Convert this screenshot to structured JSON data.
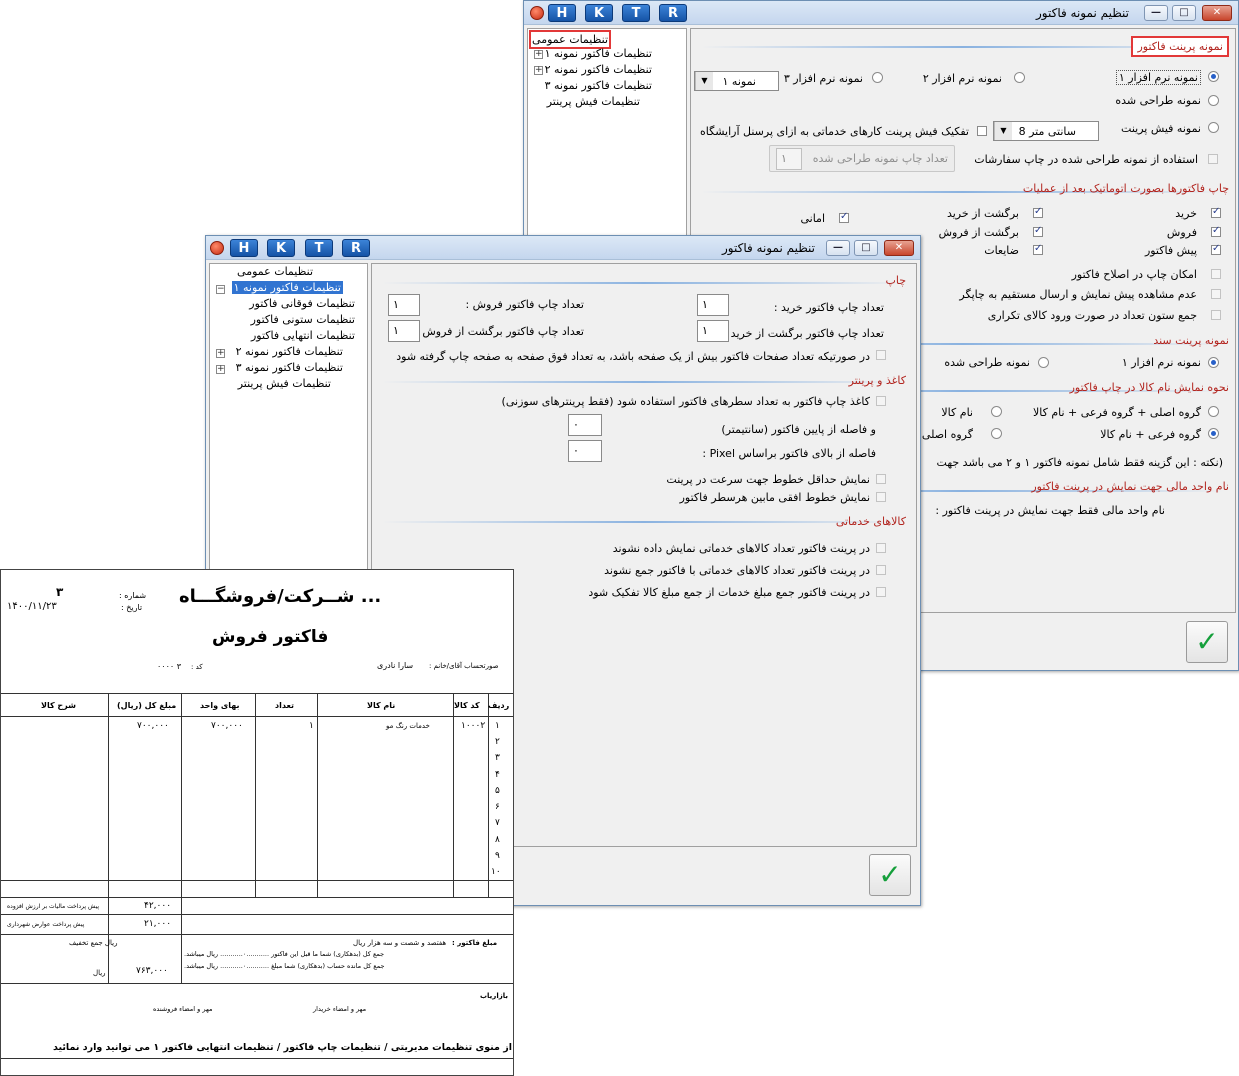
{
  "back_window": {
    "title": "تنظیم نمونه فاکتور",
    "hk_buttons": [
      "H",
      "K",
      "T",
      "R"
    ],
    "tree": [
      {
        "label": "تنظیمات عمومی"
      },
      {
        "label": "تنظیمات فاکتور نمونه ۱"
      },
      {
        "label": "تنظیمات فاکتور نمونه ۲"
      },
      {
        "label": "تنظیمات فاکتور نمونه ۳"
      },
      {
        "label": "تنظیمات فیش پرینتر"
      }
    ],
    "sec_print_sample": "نمونه پرینت فاکتور",
    "radio_soft1": "نمونه نرم افزار ۱",
    "radio_soft2": "نمونه نرم افزار ۲",
    "radio_soft3": "نمونه نرم افزار ۳",
    "combo_sample": "نمونه ۱",
    "radio_designed": "نمونه طراحی شده",
    "radio_receipt": "نمونه فیش پرینت",
    "combo_paper": "سانتی متر 8",
    "cb_separate": "تفکیک فیش پرینت کارهای خدماتی به ازای پرسنل آرایشگاه",
    "cb_use_designed": "استفاده از نمونه طراحی شده در چاپ سفارشات",
    "designed_count_label": "تعداد چاپ نمونه طراحی شده",
    "designed_count_value": "۱",
    "sec_auto_print": "چاپ فاکتورها بصورت اتوماتیک بعد از عملیات",
    "cb_buy": "خرید",
    "cb_return_buy": "برگشت از خرید",
    "cb_trust": "امانی",
    "cb_sell": "فروش",
    "cb_return_sell": "برگشت از فروش",
    "cb_pre": "پیش فاکتور",
    "cb_waste": "ضایعات",
    "cb_edit_print": "امکان چاپ در اصلاح فاکتور",
    "cb_no_preview": "عدم مشاهده پیش نمایش و ارسال مستقیم به چاپگر",
    "cb_sum_column": "جمع ستون تعداد در صورت ورود کالای تکراری",
    "sec_doc_sample": "نمونه پرینت سند",
    "radio_doc_soft1": "نمونه نرم افزار ۱",
    "radio_doc_designed": "نمونه طراحی شده",
    "sec_name_display": "نحوه نمایش نام کالا در چاپ فاکتور",
    "radio_main_sub_name": "گروه اصلی + گروه فرعی + نام کالا",
    "radio_name_only": "نام کالا",
    "radio_sub_name": "گروه فرعی + نام کالا",
    "radio_main_name": "گروه اصلی",
    "note": "(نکته : این گزینه فقط شامل نمونه فاکتور ۱ و ۲ می باشد جهت",
    "sec_currency": "نام واحد مالی جهت نمایش در پرینت فاکتور",
    "currency_label": "نام واحد مالی فقط جهت نمایش در پرینت فاکتور :"
  },
  "front_window": {
    "title": "تنظیم نمونه فاکتور",
    "hk_buttons": [
      "H",
      "K",
      "T",
      "R"
    ],
    "tree": [
      {
        "label": "تنظیمات عمومی"
      },
      {
        "label": "تنظیمات فاکتور نمونه ۱"
      },
      {
        "label": "تنظیمات فوقانی فاکتور"
      },
      {
        "label": "تنظیمات ستونی فاکتور"
      },
      {
        "label": "تنظیمات انتهایی فاکتور"
      },
      {
        "label": "تنظیمات فاکتور نمونه ۲"
      },
      {
        "label": "تنظیمات فاکتور نمونه ۳"
      },
      {
        "label": "تنظیمات فیش پرینتر"
      }
    ],
    "sec_print": "چاپ",
    "buy_count_label": "تعداد چاپ فاکتور خرید :",
    "buy_count_value": "۱",
    "sell_count_label": "تعداد چاپ فاکتور فروش :",
    "sell_count_value": "۱",
    "ret_buy_label": "تعداد چاپ فاکتور برگشت از خرید :",
    "ret_buy_value": "۱",
    "ret_sell_label": "تعداد چاپ فاکتور برگشت از فروش :",
    "ret_sell_value": "۱",
    "cb_multi_page": "در صورتیکه تعداد صفحات فاکتور بیش از یک صفحه باشد، به تعداد فوق صفحه به صفحه چاپ گرفته شود",
    "sec_paper": "کاغذ و پرینتر",
    "cb_paper_rows": "کاغذ چاپ فاکتور به تعداد سطرهای فاکتور استفاده شود (فقط پرینترهای سوزنی)",
    "bottom_margin_label": "و فاصله از پایین فاکتور (سانتیمتر)",
    "bottom_margin_value": "۰",
    "top_margin_label": "فاصله از بالای فاکتور براساس Pixel :",
    "top_margin_value": "۰",
    "cb_min_lines": "نمایش حداقل خطوط جهت سرعت در پرینت",
    "cb_hlines": "نمایش خطوط افقی مابین هرسطر فاکتور",
    "sec_service": "کالاهای خدماتی",
    "cb_svc_count": "در پرینت فاکتور تعداد کالاهای خدماتی نمایش داده نشوند",
    "cb_svc_sum": "در پرینت فاکتور تعداد کالاهای خدماتی با فاکتور جمع نشوند",
    "cb_svc_separate": "در پرینت فاکتور جمع مبلغ خدمات از جمع مبلغ کالا تفکیک شود"
  },
  "invoice": {
    "company": "... شــرکت/فروشگـــاه",
    "title": "فاکتور فروش",
    "number_label": "شماره :",
    "number_value": "۳",
    "date_label": "تاریخ :",
    "date_value": "۱۴۰۰/۱۱/۲۳",
    "customer_label": "صورتحساب  آقای/خانم :",
    "customer_name": "سارا نادری",
    "code_label": "کد :",
    "code_value": "۳ ۰۰۰۰",
    "columns": [
      "ردیف",
      "کد کالا",
      "نام کالا",
      "تعداد",
      "بهای واحد",
      "مبلغ کل (ریال)",
      "شرح کالا"
    ],
    "rows": [
      {
        "n": "۱",
        "code": "۱۰۰۰۲",
        "name": "خدمات رنگ مو",
        "qty": "۱",
        "price": "۷۰۰,۰۰۰",
        "total": "۷۰۰,۰۰۰",
        "desc": ""
      },
      {
        "n": "۲"
      },
      {
        "n": "۳"
      },
      {
        "n": "۴"
      },
      {
        "n": "۵"
      },
      {
        "n": "۶"
      },
      {
        "n": "۷"
      },
      {
        "n": "۸"
      },
      {
        "n": "۹"
      },
      {
        "n": "۱۰"
      }
    ],
    "vat_label": "پیش پرداخت مالیات بر ارزش افزوده",
    "vat_value": "۴۲,۰۰۰",
    "municipal_label": "پیش پرداخت عوارض شهرداری",
    "municipal_value": "۲۱,۰۰۰",
    "discount_label": "ریال جمع تخفیف",
    "rial_label": "ریال",
    "grand_total": "۷۶۳,۰۰۰",
    "amount_words_label": "مبلغ فاکتور :",
    "amount_words": "هفتصد و شصت و سه هزار  ریال",
    "prev_balance": "جمع کل  (بدهکاری) شما ما قبل این فاکتور ...........۰........... ریال میباشد.",
    "remaining_balance": "جمع کل مانده حساب  (بدهکاری)  شما مبلغ  ...........۰........... ریال میباشد.",
    "marketer": "بازاریاب",
    "buyer_sign": "مهر و امضاء خریدار",
    "seller_sign": "مهر و امضاء فروشنده",
    "footer_note": "توضیحات را از منوی تنظیمات مدیریتی / تنظیمات چاپ فاکتور / تنظیمات انتهایی فاکتور ۱ می توانید وارد نمائید"
  }
}
